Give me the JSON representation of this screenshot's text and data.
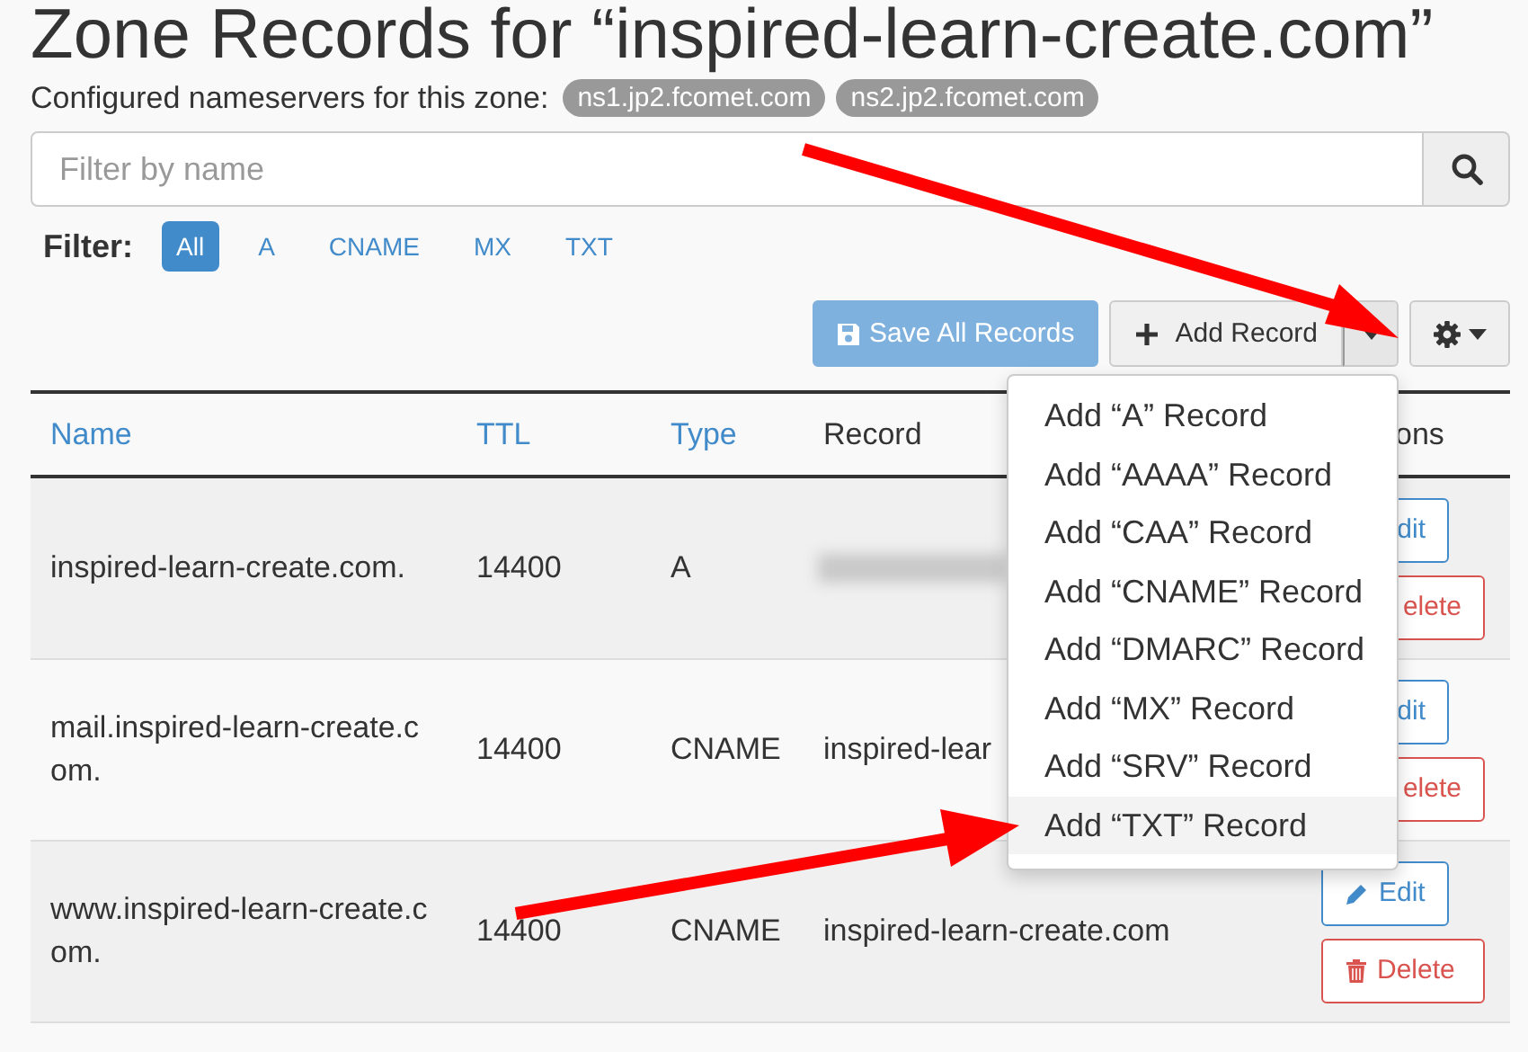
{
  "title": "Zone Records for “inspired-learn-create.com”",
  "nameservers": {
    "label": "Configured nameservers for this zone:",
    "servers": [
      "ns1.jp2.fcomet.com",
      "ns2.jp2.fcomet.com"
    ]
  },
  "search": {
    "placeholder": "Filter by name"
  },
  "filter": {
    "label": "Filter:",
    "options": [
      {
        "label": "All",
        "selected": true
      },
      {
        "label": "A",
        "selected": false
      },
      {
        "label": "CNAME",
        "selected": false
      },
      {
        "label": "MX",
        "selected": false
      },
      {
        "label": "TXT",
        "selected": false
      }
    ]
  },
  "toolbar": {
    "save": {
      "label": "Save All Records",
      "disabled": true
    },
    "add": {
      "label": "Add Record"
    },
    "menu": [
      {
        "label": "Add “A” Record",
        "selected": false
      },
      {
        "label": "Add “AAAA” Record",
        "selected": false
      },
      {
        "label": "Add “CAA” Record",
        "selected": false
      },
      {
        "label": "Add “CNAME” Record",
        "selected": false
      },
      {
        "label": "Add “DMARC” Record",
        "selected": false
      },
      {
        "label": "Add “MX” Record",
        "selected": false
      },
      {
        "label": "Add “SRV” Record",
        "selected": false
      },
      {
        "label": "Add “TXT” Record",
        "selected": true
      }
    ]
  },
  "table": {
    "columns": [
      {
        "label": "Name",
        "sortable": true
      },
      {
        "label": "TTL",
        "sortable": true
      },
      {
        "label": "Type",
        "sortable": true
      },
      {
        "label": "Record",
        "sortable": false
      },
      {
        "label": "ons",
        "sortable": false
      }
    ],
    "rows": [
      {
        "name": "inspired-learn-create.com.",
        "ttl": "14400",
        "type": "A",
        "redacted": true,
        "actions": [
          {
            "kind": "edit",
            "label": "dit",
            "clipped": true
          },
          {
            "kind": "delete",
            "label": "elete",
            "clipped": true
          }
        ]
      },
      {
        "name": "mail.inspired-learn-create.com.",
        "ttl": "14400",
        "type": "CNAME",
        "record": "inspired-lear",
        "actions": [
          {
            "kind": "edit",
            "label": "dit",
            "clipped": true
          },
          {
            "kind": "delete",
            "label": "elete",
            "clipped": true
          }
        ]
      },
      {
        "name": "www.inspired-learn-create.com.",
        "ttl": "14400",
        "type": "CNAME",
        "record": "inspired-learn-create.com",
        "actions": [
          {
            "kind": "edit",
            "label": "Edit",
            "clipped": false
          },
          {
            "kind": "delete",
            "label": "Delete",
            "clipped": false
          }
        ]
      }
    ]
  }
}
